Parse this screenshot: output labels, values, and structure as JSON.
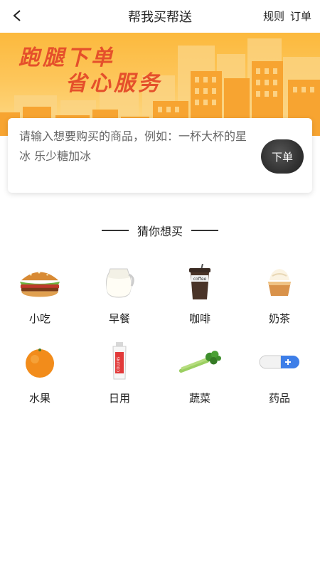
{
  "header": {
    "title": "帮我买帮送",
    "rules_label": "规则",
    "orders_label": "订单"
  },
  "banner": {
    "slogan_line1": "跑腿下单",
    "slogan_line2": "省心服务"
  },
  "order": {
    "placeholder": "请输入想要购买的商品，例如：一杯大杯的星冰 乐少糖加冰",
    "submit_label": "下单"
  },
  "guess": {
    "title": "猜你想买",
    "categories": [
      {
        "label": "小吃",
        "icon": "burger-icon"
      },
      {
        "label": "早餐",
        "icon": "milk-icon"
      },
      {
        "label": "咖啡",
        "icon": "coffee-icon"
      },
      {
        "label": "奶茶",
        "icon": "milk-tea-icon"
      },
      {
        "label": "水果",
        "icon": "orange-icon"
      },
      {
        "label": "日用",
        "icon": "toothpaste-icon"
      },
      {
        "label": "蔬菜",
        "icon": "celery-icon"
      },
      {
        "label": "药品",
        "icon": "pill-icon"
      }
    ]
  },
  "colors": {
    "accent": "#e5502b",
    "banner": "#fcb93d",
    "button": "#333333"
  }
}
